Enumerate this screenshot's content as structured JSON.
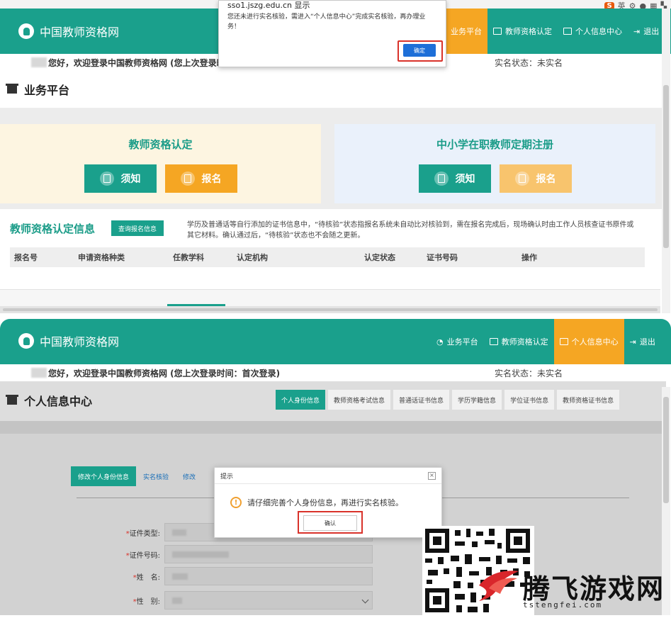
{
  "tray": {
    "ime_label": "英",
    "brand": "S"
  },
  "site": {
    "name": "中国教师资格网"
  },
  "nav1": [
    {
      "label": "业务平台",
      "active": true
    },
    {
      "label": "教师资格认定",
      "active": false
    },
    {
      "label": "个人信息中心",
      "active": false
    },
    {
      "label": "退出",
      "active": false
    }
  ],
  "nav2": [
    {
      "label": "业务平台",
      "active": false
    },
    {
      "label": "教师资格认定",
      "active": false
    },
    {
      "label": "个人信息中心",
      "active": true
    },
    {
      "label": "退出",
      "active": false
    }
  ],
  "welcome1": {
    "text": "您好，欢迎登录中国教师资格网 (您上次登录时",
    "status": "实名状态：未实名"
  },
  "welcome2": {
    "text": "您好，欢迎登录中国教师资格网 (您上次登录时间：首次登录)",
    "status": "实名状态：未实名"
  },
  "platform": {
    "title": "业务平台"
  },
  "card_left": {
    "title": "教师资格认定",
    "btn_notice": "须知",
    "btn_signup": "报名"
  },
  "card_right": {
    "title": "中小学在职教师定期注册",
    "btn_notice": "须知",
    "btn_signup": "报名"
  },
  "cert_info": {
    "title": "教师资格认定信息",
    "query_btn": "查询报名信息",
    "note": "学历及普通话等自行添加的证书信息中，“待核验”状态指报名系统未自动比对核验到，需在报名完成后，现场确认时由工作人员核查证书原件或其它材料。确认通过后，“待核验”状态也不会随之更新。",
    "columns": [
      "报名号",
      "申请资格种类",
      "任教学科",
      "认定机构",
      "认定状态",
      "证书号码",
      "操作"
    ]
  },
  "alert1": {
    "title": "sso1.jszg.edu.cn 显示",
    "message": "您还未进行实名核验，需进入“个人信息中心”完成实名核验，再办理业务！",
    "ok": "确定"
  },
  "personal": {
    "title": "个人信息中心",
    "tabs": [
      "个人身份信息",
      "教师资格考试信息",
      "普通话证书信息",
      "学历学籍信息",
      "学位证书信息",
      "教师资格证书信息"
    ],
    "subtabs": [
      "修改个人身份信息",
      "实名核验",
      "修改"
    ],
    "fields": [
      {
        "label": "证件类型:"
      },
      {
        "label": "证件号码:"
      },
      {
        "label": "姓　名:"
      },
      {
        "label": "性　别:"
      }
    ]
  },
  "alert2": {
    "title": "提示",
    "close": "×",
    "message": "请仔细完善个人身份信息，再进行实名核验。",
    "confirm": "确认"
  },
  "watermark": {
    "text": "腾飞游戏网",
    "url": "tstengfei.com"
  },
  "colors": {
    "brand_teal": "#1aa08c",
    "accent_orange": "#f5a623",
    "highlight_red": "#d9322a",
    "dialog_blue": "#1d6fd8"
  }
}
